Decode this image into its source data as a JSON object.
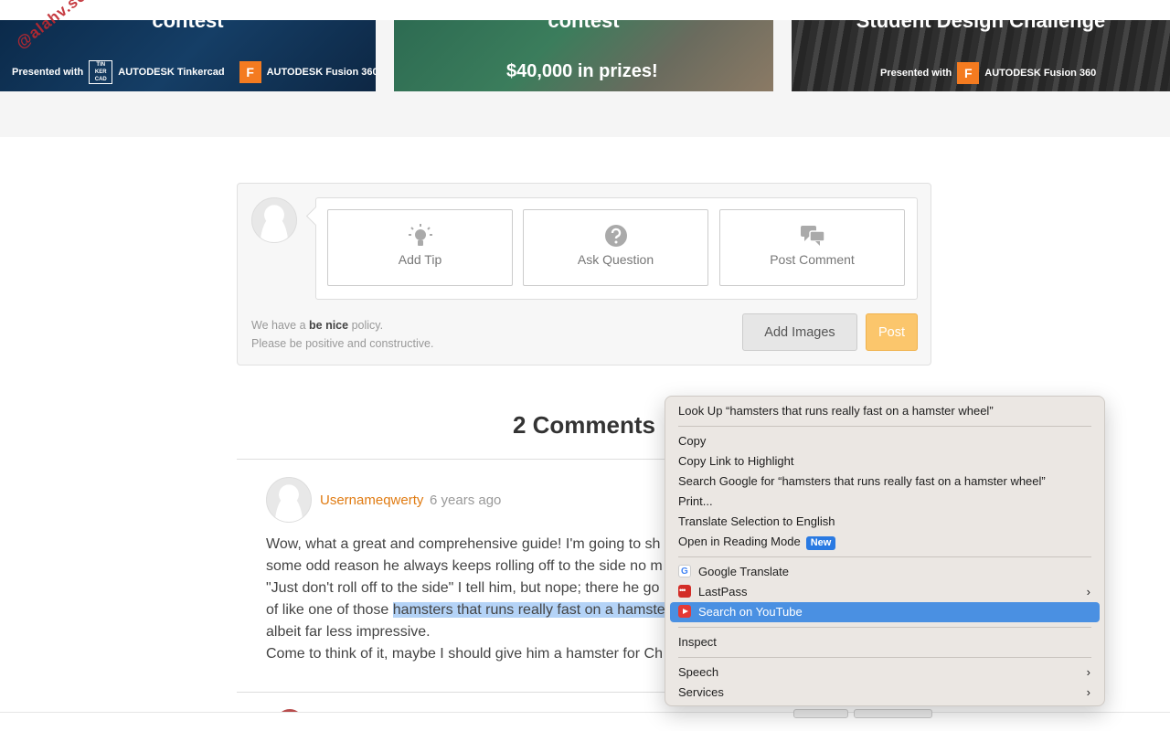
{
  "banners": [
    {
      "title": "contest",
      "presented": "Presented with",
      "tinkercad_logo": "TIN KER CAD",
      "brand1": "AUTODESK Tinkercad",
      "fusion_letter": "F",
      "brand2": "AUTODESK Fusion 360"
    },
    {
      "title": "contest",
      "prize": "$40,000 in prizes!"
    },
    {
      "title": "Student Design Challenge",
      "presented": "Presented with",
      "fusion_letter": "F",
      "brand": "AUTODESK Fusion 360"
    }
  ],
  "watermark": "@alahv.scale",
  "composer": {
    "add_tip": "Add Tip",
    "ask_question": "Ask Question",
    "post_comment": "Post Comment",
    "policy_prefix": "We have a",
    "policy_bold": "be nice",
    "policy_suffix": "policy.",
    "policy_line2": "Please be positive and constructive.",
    "add_images": "Add Images",
    "post": "Post"
  },
  "comments": {
    "title": "2 Comments",
    "items": [
      {
        "username": "Usernameqwerty",
        "time": "6 years ago",
        "line1": "Wow, what a great and comprehensive guide! I'm going to sh",
        "line2": "some odd reason he always keeps rolling off to the side no m",
        "line3": "\"Just don't roll off to the side\" I tell him, but nope; there he go",
        "line4_pre": "of like one of those ",
        "line4_hl": "hamsters that runs really fast on a hamste",
        "line5": "albeit far less impressive.",
        "line6": "Come to think of it, maybe I should give him a hamster for Ch"
      }
    ]
  },
  "context_menu": {
    "look_up": "Look Up “hamsters that runs really fast on a hamster wheel”",
    "copy": "Copy",
    "copy_link": "Copy Link to Highlight",
    "search_google": "Search Google for “hamsters that runs really fast on a hamster wheel”",
    "print": "Print...",
    "translate": "Translate Selection to English",
    "reading_mode": "Open in Reading Mode",
    "new_badge": "New",
    "google_translate": "Google Translate",
    "lastpass": "LastPass",
    "search_youtube": "Search on YouTube",
    "inspect": "Inspect",
    "speech": "Speech",
    "services": "Services",
    "chevron": "›"
  },
  "colors": {
    "accent_orange": "#e07b12",
    "post_button": "#fbc66c",
    "selection": "#4a90e2",
    "highlight": "#b4d3f7"
  }
}
